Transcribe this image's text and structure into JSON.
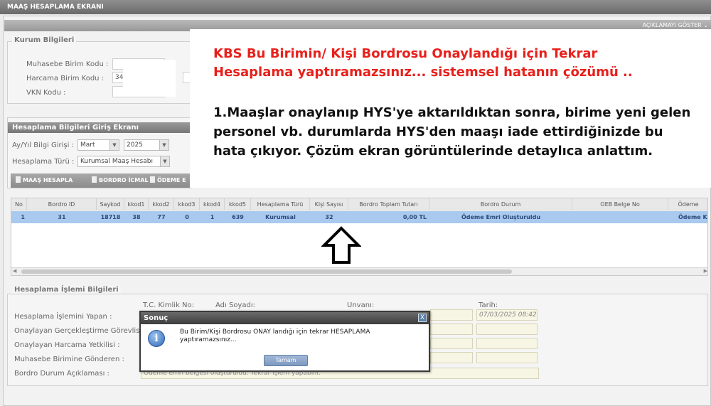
{
  "window": {
    "title": "MAAŞ HESAPLAMA EKRANI",
    "show_desc_label": "AÇIKLAMAYI GÖSTER"
  },
  "kurum": {
    "legend": "Kurum Bilgileri",
    "muhasebe_label": "Muhasebe Birim Kodu :",
    "harcama_label": "Harcama Birim Kodu :",
    "harcama_value": "34",
    "vkn_label": "VKN Kodu :"
  },
  "hesap_giris": {
    "header": "Hesaplama Bilgileri Giriş Ekranı",
    "ay_yil_label": "Ay/Yıl Bilgi Girişi :",
    "ay_value": "Mart",
    "yil_value": "2025",
    "tur_label": "Hesaplama Türü :",
    "tur_value": "Kurumsal Maaş Hesabı"
  },
  "toolbar": {
    "maas_hesapla": "MAAŞ HESAPLA",
    "bordro_icmal": "BORDRO İCMAL",
    "odeme": "ÖDEME E"
  },
  "grid": {
    "columns": [
      "No",
      "Bordro ID",
      "Saykod",
      "kkod1",
      "kkod2",
      "kkod3",
      "kkod4",
      "kkod5",
      "Hesaplama Türü",
      "Kişi Sayısı",
      "Bordro Toplam Tutarı",
      "Bordro Durum",
      "OEB Belge No",
      "Ödeme"
    ],
    "rows": [
      [
        "1",
        "31",
        "18718",
        "38",
        "77",
        "0",
        "1",
        "639",
        "Kurumsal",
        "32",
        "0,00 TL",
        "Ödeme Emri Oluşturuldu",
        "",
        "Ödeme Ki"
      ]
    ]
  },
  "islem": {
    "legend": "Hesaplama İşlemi Bilgileri",
    "tc_label": "T.C. Kimlik No:",
    "ad_label": "Adı Soyadı:",
    "unvan_label": "Unvanı:",
    "tarih_label": "Tarih:",
    "tarih_value": "07/03/2025 08:42",
    "rows": [
      "Hesaplama İşlemini Yapan :",
      "Onaylayan Gerçekleştirme Görevlisi :",
      "Onaylayan Harcama Yetkilisi :",
      "Muhasebe Birimine Gönderen :",
      "Bordro Durum Açıklaması :"
    ],
    "aciklama_value": "Ödeme emri belgesi oluşturuldu. Tekrar işlem yapabilir."
  },
  "note": {
    "title_line1": "KBS Bu Birimin/ Kişi Bordrosu Onaylandığı için Tekrar",
    "title_line2": "Hesaplama yaptıramazsınız... sistemsel hatanın çözümü ..",
    "body": "1.Maaşlar onaylanıp HYS'ye aktarıldıktan sonra, birime yeni gelen personel  vb. durumlarda HYS'den maaşı iade ettirdiğinizde bu hata çıkıyor. Çözüm ekran görüntülerinde detaylıca anlattım."
  },
  "dialog": {
    "title": "Sonuç",
    "close": "X",
    "icon": "i",
    "message": "Bu Birim/Kişi Bordrosu ONAY landığı için tekrar HESAPLAMA yaptıramazsınız...",
    "ok": "Tamam"
  }
}
